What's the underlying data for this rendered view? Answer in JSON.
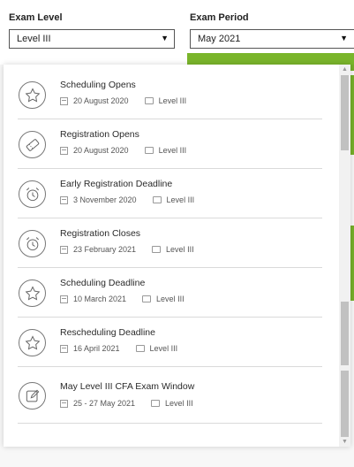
{
  "filters": {
    "exam_level_label": "Exam Level",
    "exam_level_value": "Level III",
    "exam_period_label": "Exam Period",
    "exam_period_value": "May 2021"
  },
  "events": [
    {
      "title": "Scheduling Opens",
      "date": "20 August 2020",
      "level": "Level III",
      "icon": "star-icon"
    },
    {
      "title": "Registration Opens",
      "date": "20 August 2020",
      "level": "Level III",
      "icon": "ticket-icon"
    },
    {
      "title": "Early Registration Deadline",
      "date": "3 November 2020",
      "level": "Level III",
      "icon": "alarm-clock-icon"
    },
    {
      "title": "Registration Closes",
      "date": "23 February 2021",
      "level": "Level III",
      "icon": "alarm-clock-icon"
    },
    {
      "title": "Scheduling Deadline",
      "date": "10 March 2021",
      "level": "Level III",
      "icon": "star-icon"
    },
    {
      "title": "Rescheduling Deadline",
      "date": "16 April 2021",
      "level": "Level III",
      "icon": "star-icon"
    },
    {
      "title": "May Level III CFA Exam Window",
      "date": "25 - 27 May 2021",
      "level": "Level III",
      "icon": "edit-icon"
    }
  ],
  "colors": {
    "accent": "#7ab52b"
  }
}
